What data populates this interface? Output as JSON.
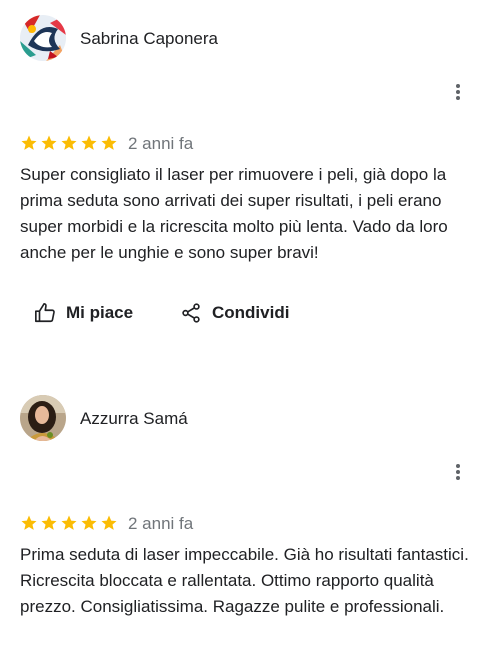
{
  "reviews": [
    {
      "author": "Sabrina Caponera",
      "rating": 5,
      "date": "2 anni fa",
      "text": "Super consigliato il laser per rimuovere i peli, già dopo la prima seduta sono arrivati dei super risultati, i peli erano super morbidi e la ricrescita molto più lenta. Vado da loro anche per le unghie e sono super bravi!",
      "like_label": "Mi piace",
      "share_label": "Condividi"
    },
    {
      "author": "Azzurra Samá",
      "rating": 5,
      "date": "2 anni fa",
      "text": "Prima seduta di laser impeccabile. Già ho risultati fantastici. Ricrescita bloccata e rallentata. Ottimo rapporto qualità prezzo. Consigliatissima. Ragazze pulite e professionali."
    }
  ],
  "colors": {
    "star": "#fbbc04",
    "text": "#202124",
    "muted": "#70757a",
    "icon": "#5f6368"
  },
  "icons": [
    "more-vert-icon",
    "star-icon",
    "thumb-up-icon",
    "share-icon"
  ]
}
